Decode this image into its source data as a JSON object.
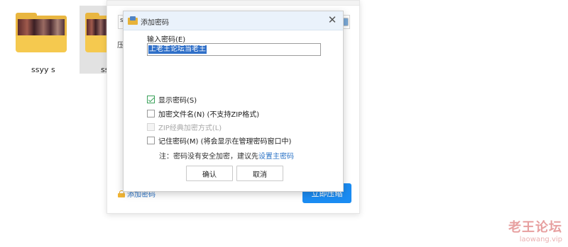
{
  "desktop": {
    "folders": [
      {
        "name": "ssyy s"
      },
      {
        "name": "ss"
      }
    ]
  },
  "background_window": {
    "fragment_s": "s",
    "fragment_ya": "压",
    "add_password_link": "添加密码",
    "compress_button": "立即压缩"
  },
  "dialog": {
    "title": "添加密码",
    "close_glyph": "✕",
    "password_label": "输入密码(E)",
    "password_value": "上老王论坛当老王",
    "options": {
      "show_password": {
        "label": "显示密码(S)",
        "checked": true
      },
      "encrypt_filenames": {
        "label": "加密文件名(N) (不支持ZIP格式)",
        "checked": false
      },
      "zip_classic": {
        "label": "ZIP经典加密方式(L)",
        "checked": false,
        "disabled": true
      },
      "remember_password": {
        "label": "记住密码(M) (将会显示在管理密码窗口中)",
        "checked": false
      }
    },
    "note_prefix": "注：密码没有安全加密，建议先",
    "note_link": "设置主密码",
    "ok_button": "确认",
    "cancel_button": "取消"
  },
  "watermark": {
    "line1": "老王论坛",
    "line2": "laowang.vip"
  }
}
